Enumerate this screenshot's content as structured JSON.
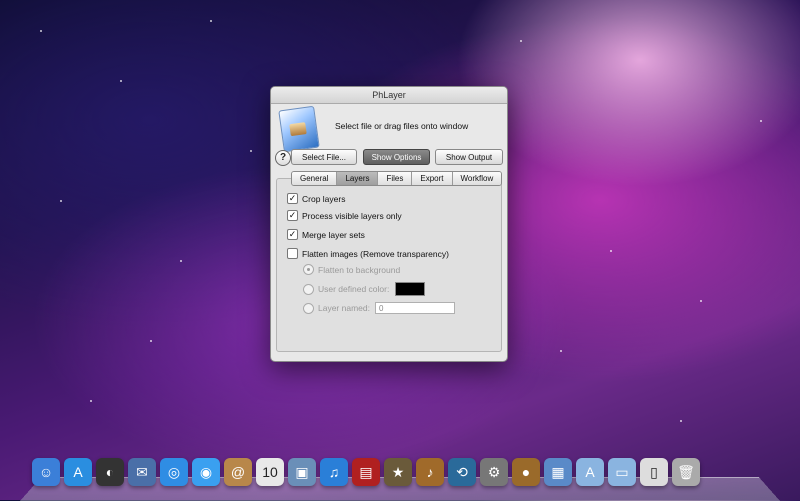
{
  "window": {
    "title": "PhLayer",
    "instruction": "Select file or drag files onto window",
    "help_label": "?",
    "buttons": {
      "select_file": "Select File...",
      "show_options": "Show Options",
      "show_output": "Show Output"
    },
    "tabs": [
      "General",
      "Layers",
      "Files",
      "Export",
      "Workflow"
    ],
    "selected_tab": "Layers",
    "options": {
      "crop_layers": {
        "label": "Crop layers",
        "checked": true
      },
      "process_visible": {
        "label": "Process visible layers only",
        "checked": true
      },
      "merge_layer_sets": {
        "label": "Merge layer sets",
        "checked": true
      },
      "flatten_images": {
        "label": "Flatten images (Remove transparency)",
        "checked": false
      },
      "flatten_to_background": {
        "label": "Flatten to background",
        "selected": true,
        "enabled": false
      },
      "user_defined_color": {
        "label": "User defined color:",
        "selected": false,
        "enabled": false,
        "color": "#000000"
      },
      "layer_named": {
        "label": "Layer named:",
        "selected": false,
        "enabled": false,
        "value": "0"
      }
    }
  },
  "dock": {
    "icons": [
      {
        "name": "finder-icon",
        "glyph": "☺",
        "color": "#3b7fd8"
      },
      {
        "name": "app-store-icon",
        "glyph": "A",
        "color": "#2a8ee0"
      },
      {
        "name": "dashboard-icon",
        "glyph": "◐",
        "color": "#333333"
      },
      {
        "name": "mail-stamp-icon",
        "glyph": "✉",
        "color": "#4a6fa8"
      },
      {
        "name": "safari-icon",
        "glyph": "◎",
        "color": "#2f8de4"
      },
      {
        "name": "ichat-icon",
        "glyph": "◉",
        "color": "#3aa0f0"
      },
      {
        "name": "address-book-icon",
        "glyph": "@",
        "color": "#b8874a"
      },
      {
        "name": "ical-icon",
        "glyph": "10",
        "color": "#e8e8e8"
      },
      {
        "name": "iphoto-icon",
        "glyph": "▣",
        "color": "#6a8fb8"
      },
      {
        "name": "itunes-icon",
        "glyph": "♫",
        "color": "#2a7fd8"
      },
      {
        "name": "photo-booth-icon",
        "glyph": "▤",
        "color": "#b02020"
      },
      {
        "name": "imovie-icon",
        "glyph": "★",
        "color": "#6a5a3a"
      },
      {
        "name": "garageband-icon",
        "glyph": "♪",
        "color": "#a06a2a"
      },
      {
        "name": "time-machine-icon",
        "glyph": "⟲",
        "color": "#2a6a9a"
      },
      {
        "name": "system-preferences-icon",
        "glyph": "⚙",
        "color": "#777777"
      },
      {
        "name": "acorn-icon",
        "glyph": "●",
        "color": "#9a6a2a"
      },
      {
        "name": "phlayer-dock-icon",
        "glyph": "▦",
        "color": "#5a8ac8"
      },
      {
        "name": "applications-folder-icon",
        "glyph": "A",
        "color": "#8ab4e0"
      },
      {
        "name": "documents-folder-icon",
        "glyph": "▭",
        "color": "#8ab4e0"
      },
      {
        "name": "downloads-icon",
        "glyph": "▯",
        "color": "#dddddd"
      },
      {
        "name": "trash-icon",
        "glyph": "🗑",
        "color": "#aaaaaa"
      }
    ]
  }
}
